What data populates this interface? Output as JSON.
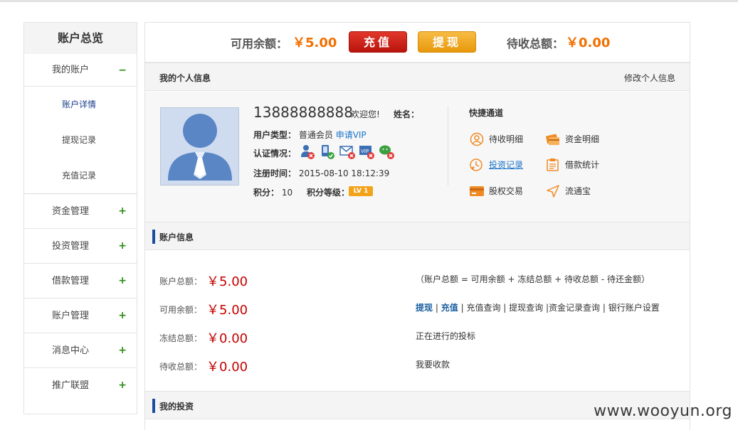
{
  "sidebar": {
    "title": "账户总览",
    "open_section": {
      "label": "我的账户",
      "toggle": "−"
    },
    "sub_items": [
      {
        "label": "账户详情"
      },
      {
        "label": "提现记录"
      },
      {
        "label": "充值记录"
      }
    ],
    "items": [
      {
        "label": "资金管理",
        "toggle": "+"
      },
      {
        "label": "投资管理",
        "toggle": "+"
      },
      {
        "label": "借款管理",
        "toggle": "+"
      },
      {
        "label": "账户管理",
        "toggle": "+"
      },
      {
        "label": "消息中心",
        "toggle": "+"
      },
      {
        "label": "推广联盟",
        "toggle": "+"
      }
    ]
  },
  "balance_bar": {
    "available_label": "可用余额：",
    "available_value": "￥5.00",
    "recharge_button": "充值",
    "withdraw_button": "提现",
    "pending_label": "待收总额：",
    "pending_value": "￥0.00"
  },
  "profile": {
    "section_title": "我的个人信息",
    "edit_link": "修改个人信息",
    "phone": "13888888888",
    "welcome": "欢迎您!",
    "name_label": "姓名：",
    "user_type_label": "用户类型：",
    "user_type_value": "普通会员",
    "vip_link": "申请VIP",
    "cert_label": "认证情况：",
    "reg_label": "注册时间：",
    "reg_value": "2015-08-10 18:12:39",
    "points_label": "积分：",
    "points_value": "10",
    "level_label": "积分等级：",
    "level_badge": "LV 1"
  },
  "quick_links": {
    "title": "快捷通道",
    "items": [
      {
        "label": "待收明细",
        "icon": "pending-detail-icon"
      },
      {
        "label": "资金明细",
        "icon": "fund-detail-icon"
      },
      {
        "label": "投资记录",
        "icon": "invest-record-icon"
      },
      {
        "label": "借款统计",
        "icon": "loan-stats-icon"
      },
      {
        "label": "股权交易",
        "icon": "equity-trade-icon"
      },
      {
        "label": "流通宝",
        "icon": "liutongbao-icon"
      }
    ]
  },
  "account_info": {
    "section_title": "账户信息",
    "rows": [
      {
        "label": "账户总额：",
        "value": "￥5.00"
      },
      {
        "label": "可用余额：",
        "value": "￥5.00"
      },
      {
        "label": "冻结总额：",
        "value": "￥0.00"
      },
      {
        "label": "待收总额：",
        "value": "￥0.00"
      }
    ],
    "formula": "（账户总额 = 可用余额 + 冻结总额 + 待收总额 - 待还金额）",
    "actions": {
      "withdraw": "提现",
      "recharge": "充值",
      "sep": "|",
      "recharge_query": "充值查询",
      "withdraw_query": "提现查询",
      "fund_query": "资金记录查询",
      "bank_settings": "银行账户设置"
    },
    "ongoing_bids": "正在进行的投标",
    "want_collect": "我要收款"
  },
  "my_investment": {
    "section_title": "我的投资"
  },
  "watermark": "www.wooyun.org"
}
